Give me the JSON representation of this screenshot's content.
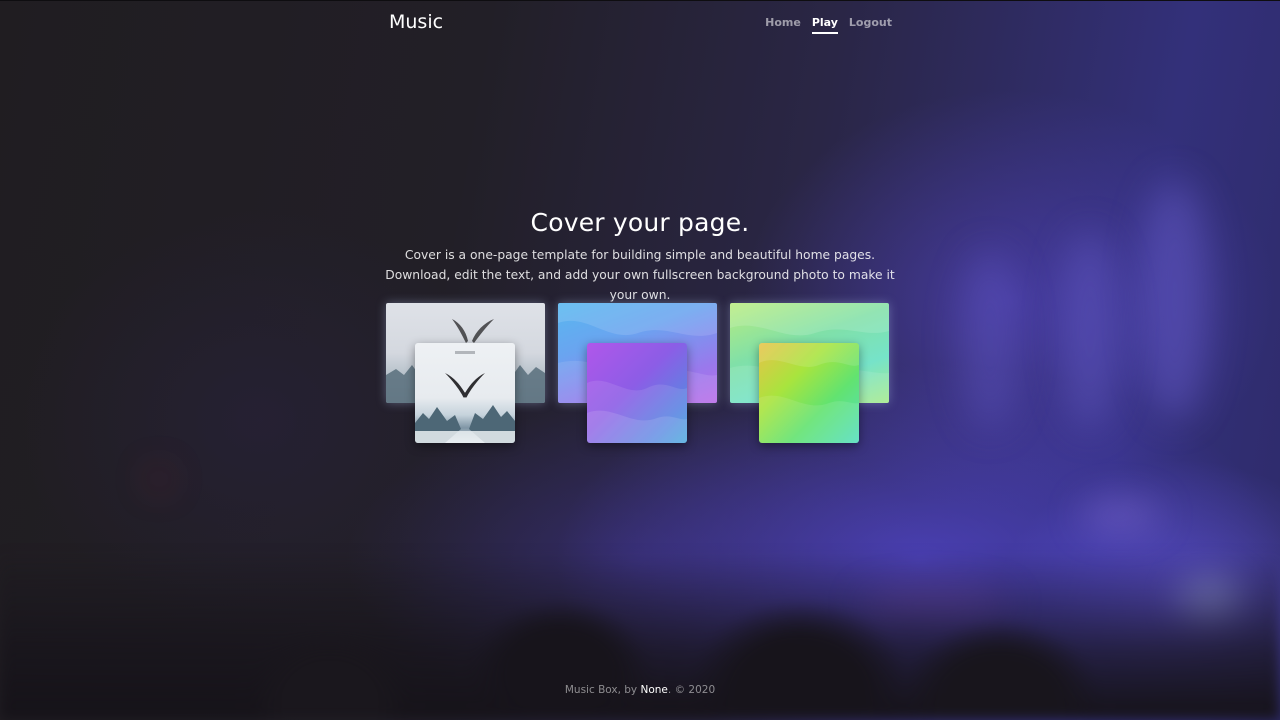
{
  "header": {
    "brand": "Music",
    "nav": [
      {
        "label": "Home",
        "active": false
      },
      {
        "label": "Play",
        "active": true
      },
      {
        "label": "Logout",
        "active": false
      }
    ]
  },
  "hero": {
    "title": "Cover your page.",
    "lead": "Cover is a one-page template for building simple and beautiful home pages. Download, edit the text, and add your own fullscreen background photo to make it your own."
  },
  "cards": [
    {
      "name": "mountain-eagles-album",
      "accent": "#c9d1da"
    },
    {
      "name": "blue-purple-waves-album",
      "accent": "#8c5de6"
    },
    {
      "name": "green-yellow-waves-album",
      "accent": "#62e370"
    }
  ],
  "footer": {
    "prefix": "Music Box, by ",
    "author": "None",
    "suffix": ". © 2020"
  }
}
